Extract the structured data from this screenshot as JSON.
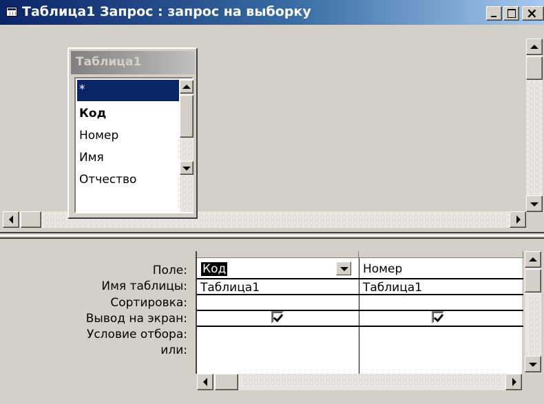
{
  "window": {
    "title": "Таблица1 Запрос : запрос на выборку",
    "icon": "query-grid-icon"
  },
  "field_list": {
    "title": "Таблица1",
    "items": [
      {
        "label": "*",
        "selected": true,
        "bold": false
      },
      {
        "label": "Код",
        "selected": false,
        "bold": true
      },
      {
        "label": "Номер",
        "selected": false,
        "bold": false
      },
      {
        "label": "Имя",
        "selected": false,
        "bold": false
      },
      {
        "label": "Отчество",
        "selected": false,
        "bold": false
      }
    ]
  },
  "grid": {
    "row_labels": [
      "Поле:",
      "Имя таблицы:",
      "Сортировка:",
      "Вывод на экран:",
      "Условие отбора:",
      "или:"
    ],
    "columns": [
      {
        "field": "Код",
        "table": "Таблица1",
        "sort": "",
        "show": true,
        "criteria": "",
        "or": ""
      },
      {
        "field": "Номер",
        "table": "Таблица1",
        "sort": "",
        "show": true,
        "criteria": "",
        "or": ""
      }
    ]
  }
}
